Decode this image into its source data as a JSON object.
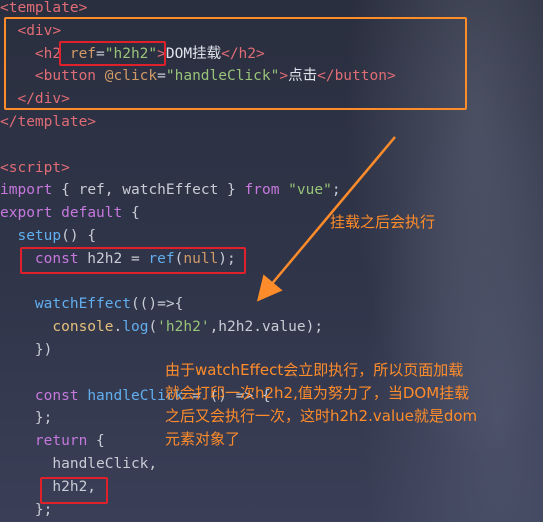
{
  "code_lines": [
    {
      "parts": [
        {
          "t": "<template>",
          "c": "tag"
        }
      ]
    },
    {
      "parts": [
        {
          "t": "  <div>",
          "c": "tag"
        }
      ]
    },
    {
      "parts": [
        {
          "t": "    <h2",
          "c": "tag"
        },
        {
          "t": " ref",
          "c": "attr"
        },
        {
          "t": "=",
          "c": "plain"
        },
        {
          "t": "\"h2h2\"",
          "c": "str"
        },
        {
          "t": ">",
          "c": "tag"
        },
        {
          "t": "DOM挂载",
          "c": "txt"
        },
        {
          "t": "</h2>",
          "c": "tag"
        }
      ]
    },
    {
      "parts": [
        {
          "t": "    <button",
          "c": "tag"
        },
        {
          "t": " @click",
          "c": "attr"
        },
        {
          "t": "=",
          "c": "plain"
        },
        {
          "t": "\"handleClick\"",
          "c": "str"
        },
        {
          "t": ">",
          "c": "tag"
        },
        {
          "t": "点击",
          "c": "txt"
        },
        {
          "t": "</button>",
          "c": "tag"
        }
      ]
    },
    {
      "parts": [
        {
          "t": "  </div>",
          "c": "tag"
        }
      ]
    },
    {
      "parts": [
        {
          "t": "</template>",
          "c": "tag"
        }
      ]
    },
    {
      "parts": [
        {
          "t": "",
          "c": "plain"
        }
      ]
    },
    {
      "parts": [
        {
          "t": "<script>",
          "c": "tag"
        }
      ]
    },
    {
      "parts": [
        {
          "t": "import",
          "c": "kw"
        },
        {
          "t": " { ",
          "c": "plain"
        },
        {
          "t": "ref",
          "c": "plain"
        },
        {
          "t": ", ",
          "c": "plain"
        },
        {
          "t": "watchEffect",
          "c": "plain"
        },
        {
          "t": " } ",
          "c": "plain"
        },
        {
          "t": "from",
          "c": "kw"
        },
        {
          "t": " ",
          "c": "plain"
        },
        {
          "t": "\"vue\"",
          "c": "str"
        },
        {
          "t": ";",
          "c": "plain"
        }
      ]
    },
    {
      "parts": [
        {
          "t": "export",
          "c": "kw"
        },
        {
          "t": " ",
          "c": "plain"
        },
        {
          "t": "default",
          "c": "kw"
        },
        {
          "t": " {",
          "c": "plain"
        }
      ]
    },
    {
      "parts": [
        {
          "t": "  ",
          "c": "plain"
        },
        {
          "t": "setup",
          "c": "fn"
        },
        {
          "t": "() {",
          "c": "plain"
        }
      ]
    },
    {
      "parts": [
        {
          "t": "    ",
          "c": "plain"
        },
        {
          "t": "const",
          "c": "kw"
        },
        {
          "t": " h2h2 = ",
          "c": "plain"
        },
        {
          "t": "ref",
          "c": "fn"
        },
        {
          "t": "(",
          "c": "plain"
        },
        {
          "t": "null",
          "c": "attr"
        },
        {
          "t": ");",
          "c": "plain"
        }
      ]
    },
    {
      "parts": [
        {
          "t": "",
          "c": "plain"
        }
      ]
    },
    {
      "parts": [
        {
          "t": "    ",
          "c": "plain"
        },
        {
          "t": "watchEffect",
          "c": "fn"
        },
        {
          "t": "(()=>{",
          "c": "plain"
        }
      ]
    },
    {
      "parts": [
        {
          "t": "      ",
          "c": "plain"
        },
        {
          "t": "console",
          "c": "var"
        },
        {
          "t": ".",
          "c": "plain"
        },
        {
          "t": "log",
          "c": "fn"
        },
        {
          "t": "(",
          "c": "plain"
        },
        {
          "t": "'h2h2'",
          "c": "str"
        },
        {
          "t": ",h2h2.value);",
          "c": "plain"
        }
      ]
    },
    {
      "parts": [
        {
          "t": "    })",
          "c": "plain"
        }
      ]
    },
    {
      "parts": [
        {
          "t": "",
          "c": "plain"
        }
      ]
    },
    {
      "parts": [
        {
          "t": "    ",
          "c": "plain"
        },
        {
          "t": "const",
          "c": "kw"
        },
        {
          "t": " ",
          "c": "plain"
        },
        {
          "t": "handleClick",
          "c": "fn"
        },
        {
          "t": " = () => {",
          "c": "plain"
        }
      ]
    },
    {
      "parts": [
        {
          "t": "    };",
          "c": "plain"
        }
      ]
    },
    {
      "parts": [
        {
          "t": "    ",
          "c": "plain"
        },
        {
          "t": "return",
          "c": "kw"
        },
        {
          "t": " {",
          "c": "plain"
        }
      ]
    },
    {
      "parts": [
        {
          "t": "      handleClick,",
          "c": "plain"
        }
      ]
    },
    {
      "parts": [
        {
          "t": "      h2h2,",
          "c": "plain"
        }
      ]
    },
    {
      "parts": [
        {
          "t": "    };",
          "c": "plain"
        }
      ]
    }
  ],
  "annotations": {
    "mounted_note": "挂载之后会执行",
    "explain_note": "由于watchEffect会立即执行，所以页面加载\n就会打印一次h2h2,值为努力了，当DOM挂载\n之后又会执行一次，这时h2h2.value就是dom\n元素对象了"
  },
  "colors": {
    "annotation": "#ff8c2a",
    "highlight_box": "#e0202a"
  }
}
